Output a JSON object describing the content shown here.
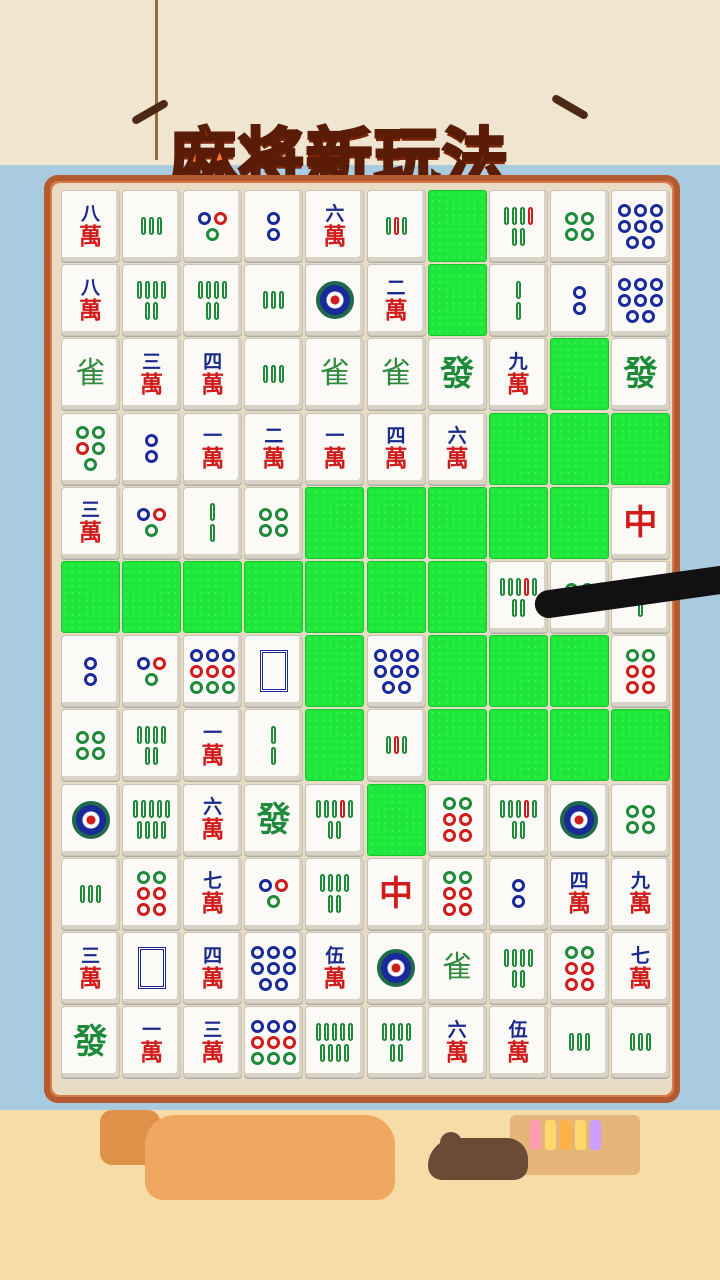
{
  "title": "麻将新玩法",
  "grid": {
    "cols": 10,
    "rows": 12,
    "tiles": [
      [
        "m:八",
        "b:3g",
        "c:3",
        "c:2",
        "m:六",
        "b:3r",
        "E",
        "b:6r",
        "c:4",
        "c:8b"
      ],
      [
        "m:八",
        "b:6",
        "b:6",
        "b:3",
        "c:1big",
        "m:二",
        "E",
        "b:2",
        "c:2b",
        "c:8b"
      ],
      [
        "bird",
        "m:三",
        "m:四",
        "b:3",
        "bird",
        "bird",
        "fa",
        "m:九",
        "E",
        "fa"
      ],
      [
        "c:5",
        "c:2b",
        "m:一",
        "m:二",
        "m:一",
        "m:四",
        "m:六",
        "E",
        "E",
        "E"
      ],
      [
        "m:三",
        "c:3",
        "b:2",
        "c:4",
        "E",
        "E",
        "E",
        "E",
        "E",
        "zh"
      ],
      [
        "E",
        "E",
        "E",
        "E",
        "E",
        "E",
        "E",
        "b:7r",
        "c:3g",
        "b:2"
      ],
      [
        "c:2b",
        "c:3",
        "c:9",
        "frame",
        "E",
        "c:8b",
        "E",
        "E",
        "E",
        "c:6"
      ],
      [
        "c:4",
        "b:6",
        "m:一",
        "b:2",
        "E",
        "b:3r",
        "E",
        "E",
        "E",
        "E"
      ],
      [
        "c:1big",
        "b:9",
        "m:六",
        "fa",
        "b:7r",
        "E",
        "c:6",
        "b:7r",
        "c:1big",
        "c:4"
      ],
      [
        "b:3",
        "c:6",
        "m:七",
        "c:3",
        "b:6",
        "zh",
        "c:6",
        "c:2b",
        "m:四",
        "m:九"
      ],
      [
        "m:三",
        "frame",
        "m:四",
        "c:8b",
        "m:伍",
        "c:1big",
        "bird",
        "b:6",
        "c:6",
        "m:七"
      ],
      [
        "fa",
        "m:一",
        "m:三",
        "c:9",
        "b:9",
        "b:6",
        "m:六",
        "m:伍",
        "b:3",
        "b:3"
      ]
    ]
  },
  "labels": {
    "man": "萬",
    "fa": "發",
    "zhong": "中",
    "bird": "雀"
  },
  "colors": {
    "empty_cell": "#1ee63b",
    "tile_face": "#fbfaf6",
    "character_red": "#d11c1c",
    "numeral_blue": "#1a2a8a",
    "bamboo_green": "#1f8a3a",
    "title_orange": "#ff7a1a",
    "board_frame": "#d77a4a"
  }
}
